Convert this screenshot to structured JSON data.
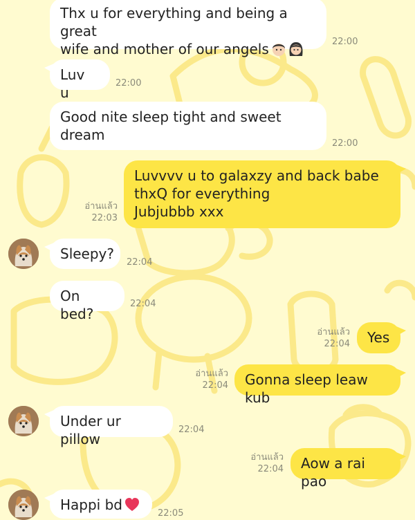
{
  "messages": [
    {
      "id": "m1",
      "side": "in",
      "text": "Thx u for everything and being a great\nwife and mother of our angels",
      "time": "22:00",
      "emoji": [
        "man-face-icon",
        "woman-face-icon"
      ]
    },
    {
      "id": "m2",
      "side": "in",
      "text": "Luv  u",
      "time": "22:00"
    },
    {
      "id": "m3",
      "side": "in",
      "text": "Good nite sleep tight and sweet\ndream",
      "time": "22:00"
    },
    {
      "id": "m4",
      "side": "out",
      "text": "Luvvvv u to galaxzy and back babe\nthxQ for everything\nJubjubbb xxx",
      "time": "22:03",
      "read": "อ่านแล้ว"
    },
    {
      "id": "m5",
      "side": "in",
      "text": "Sleepy?",
      "time": "22:04",
      "avatar": true
    },
    {
      "id": "m6",
      "side": "in",
      "text": "On bed?",
      "time": "22:04"
    },
    {
      "id": "m7",
      "side": "out",
      "text": "Yes",
      "time": "22:04",
      "read": "อ่านแล้ว"
    },
    {
      "id": "m8",
      "side": "out",
      "text": "Gonna sleep leaw kub",
      "time": "22:04",
      "read": "อ่านแล้ว"
    },
    {
      "id": "m9",
      "side": "in",
      "text": "Under ur pillow",
      "time": "22:04",
      "avatar": true
    },
    {
      "id": "m10",
      "side": "out",
      "text": "Aow a rai pao",
      "time": "22:04",
      "read": "อ่านแล้ว"
    },
    {
      "id": "m11",
      "side": "in",
      "text": "Happi bd",
      "time": "22:05",
      "avatar": true,
      "emoji": [
        "heart-icon"
      ]
    }
  ],
  "colors": {
    "background": "#fffbd0",
    "incoming": "#ffffff",
    "outgoing": "#fde546",
    "meta": "#8a8a7a"
  },
  "avatar": {
    "icon": "shiba-dog-avatar"
  }
}
